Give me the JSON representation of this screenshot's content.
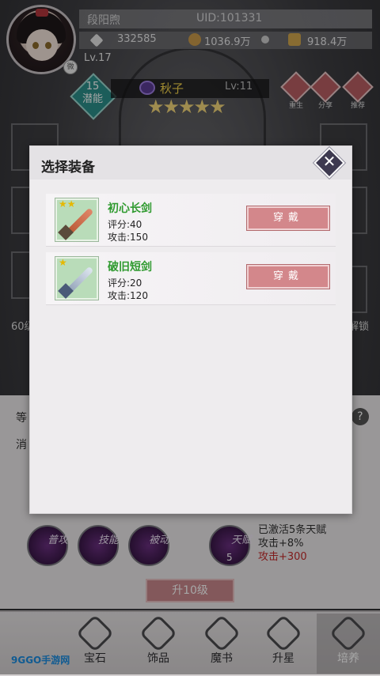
{
  "player": {
    "name": "段阳煦",
    "uid": "UID:101331",
    "power": "332585",
    "gold": "1036.9万",
    "bells": "918.4万",
    "level": "Lv.17",
    "vip_badge": "微"
  },
  "hero": {
    "potential_number": "15",
    "potential_label": "潜能",
    "name": "秋子",
    "level": "Lv:11",
    "stars": 5,
    "stars_text": "★★★★★"
  },
  "side_actions": [
    {
      "label": "重生"
    },
    {
      "label": "分享"
    },
    {
      "label": "推荐"
    }
  ],
  "background": {
    "left_text": "60级",
    "right_text": "解锁",
    "row1_label": "等",
    "row2_label": "消",
    "help_glyph": "?",
    "skills": [
      {
        "label": "普攻"
      },
      {
        "label": "技能"
      },
      {
        "label": "被动"
      }
    ],
    "talent": {
      "label": "天赋",
      "count": "5",
      "line1": "已激活5条天赋",
      "line2": "攻击+8%",
      "line3": "攻击+300"
    },
    "upgrade_button": "升10级"
  },
  "modal": {
    "title": "选择装备",
    "close_glyph": "✕",
    "items": [
      {
        "name": "初心长剑",
        "score": "评分:40",
        "attack": "攻击:150",
        "button": "穿戴",
        "stars": "★★"
      },
      {
        "name": "破旧短剑",
        "score": "评分:20",
        "attack": "攻击:120",
        "button": "穿戴",
        "stars": "★"
      }
    ]
  },
  "nav": [
    {
      "label": "宝石",
      "icon": "gem-icon"
    },
    {
      "label": "饰品",
      "icon": "accessory-icon"
    },
    {
      "label": "魔书",
      "icon": "magic-book-icon"
    },
    {
      "label": "升星",
      "icon": "star-up-icon"
    },
    {
      "label": "培养",
      "icon": "cultivate-icon",
      "active": true
    }
  ],
  "watermark": "9GGO手游网",
  "colors": {
    "equip_name": "#2f9a2f",
    "wear_button": "#d3878b",
    "hero_name": "#f2d24a",
    "stars": "#f4d77a",
    "potential_badge": "#2b8f8a",
    "red_text": "#c42a2a"
  }
}
